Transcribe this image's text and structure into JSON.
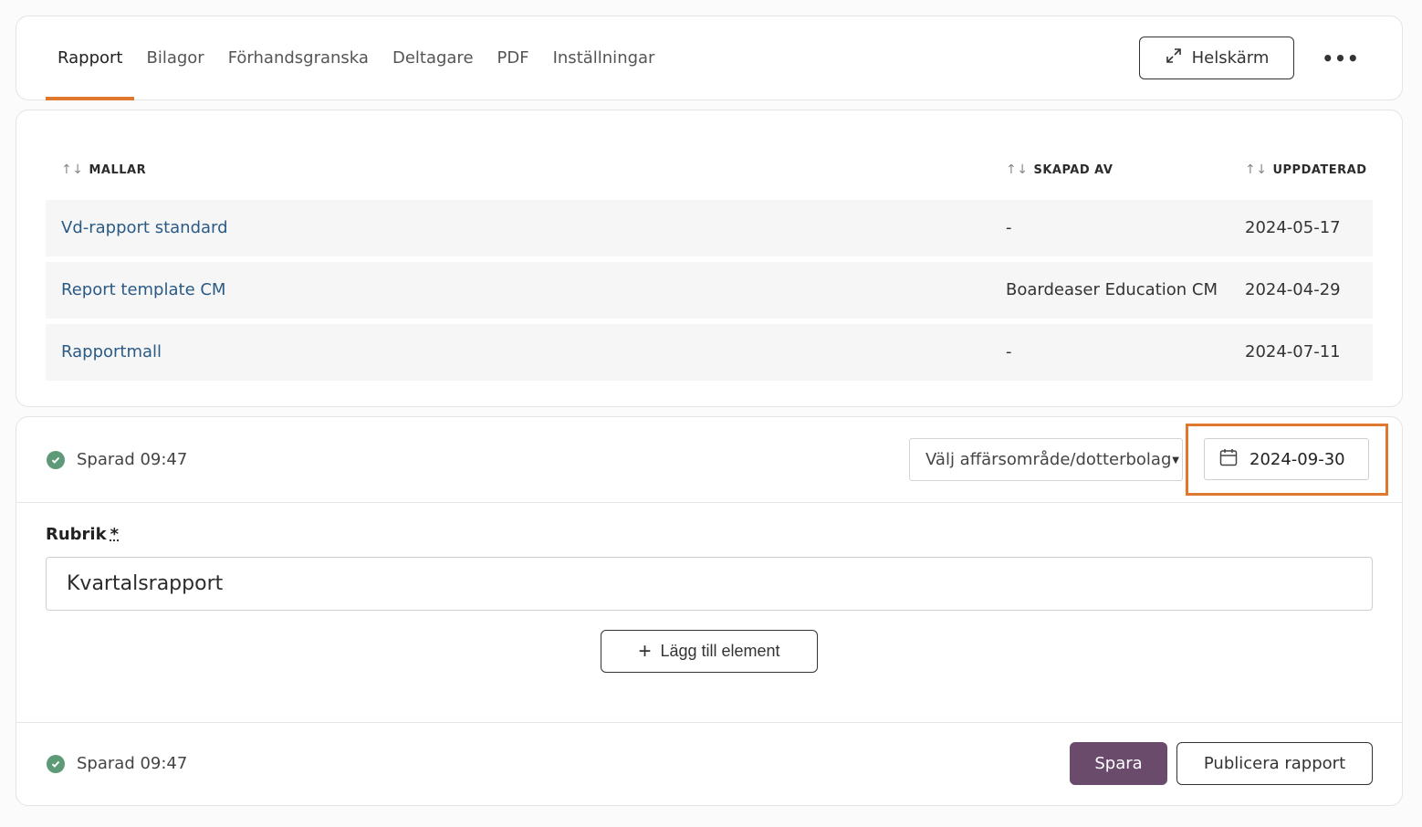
{
  "tabs": [
    {
      "label": "Rapport",
      "active": true
    },
    {
      "label": "Bilagor",
      "active": false
    },
    {
      "label": "Förhandsgranska",
      "active": false
    },
    {
      "label": "Deltagare",
      "active": false
    },
    {
      "label": "PDF",
      "active": false
    },
    {
      "label": "Inställningar",
      "active": false
    }
  ],
  "header": {
    "fullscreen_label": "Helskärm",
    "fullscreen_icon": "expand-arrows-icon",
    "more_label": "•••",
    "more_icon": "more-dots-icon"
  },
  "templates_table": {
    "columns": {
      "name": "MALLAR",
      "creator": "SKAPAD AV",
      "updated": "UPPDATERAD"
    },
    "sort_icon": "↑↓",
    "rows": [
      {
        "name": "Vd-rapport standard",
        "creator": "-",
        "updated": "2024-05-17"
      },
      {
        "name": "Report template CM",
        "creator": "Boardeaser Education CM",
        "updated": "2024-04-29"
      },
      {
        "name": "Rapportmall",
        "creator": "-",
        "updated": "2024-07-11"
      }
    ]
  },
  "editor": {
    "saved_status_top": "Sparad 09:47",
    "saved_status_bottom": "Sparad 09:47",
    "business_select_value": "Välj affärsområde/dotterbolag",
    "date_value": "2024-09-30",
    "title_label": "Rubrik",
    "required_marker": "*",
    "title_value": "Kvartalsrapport",
    "add_element_label": "Lägg till element",
    "save_label": "Spara",
    "publish_label": "Publicera rapport"
  },
  "colors": {
    "accent_orange": "#e0772f",
    "link_blue": "#2a5a85",
    "save_purple": "#6a4b6c",
    "success_green": "#5e9a78"
  }
}
